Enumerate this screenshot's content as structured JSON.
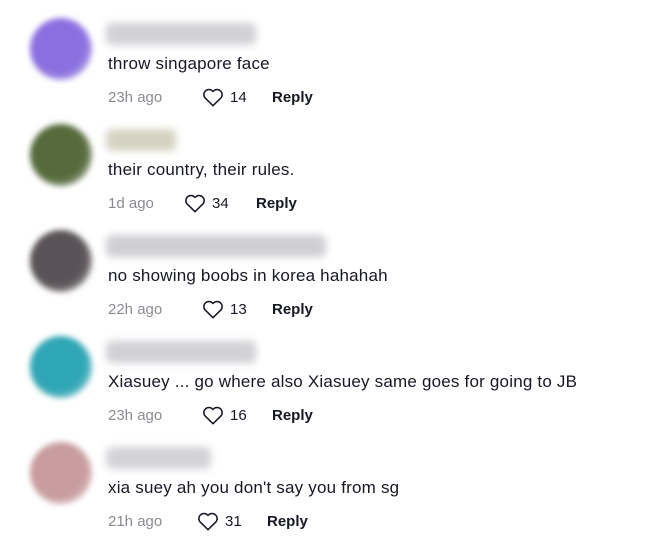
{
  "comments": [
    {
      "text": "throw singapore face",
      "time": "23h ago",
      "likes": "14",
      "reply": "Reply",
      "avatar_color": "#8b6fe0",
      "username_color": "#c9c9cf",
      "username_width": 150
    },
    {
      "text": "their country, their rules.",
      "time": "1d ago",
      "likes": "34",
      "reply": "Reply",
      "avatar_color": "#556b3c",
      "username_color": "#cfcab8",
      "username_width": 70
    },
    {
      "text": "no showing boobs in korea hahahah",
      "time": "22h ago",
      "likes": "13",
      "reply": "Reply",
      "avatar_color": "#5a5256",
      "username_color": "#c6c6cc",
      "username_width": 220
    },
    {
      "text": "Xiasuey ... go where also Xiasuey same goes for going to JB",
      "time": "23h ago",
      "likes": "16",
      "reply": "Reply",
      "avatar_color": "#2fa6b5",
      "username_color": "#c8c8ce",
      "username_width": 150
    },
    {
      "text": "xia suey ah you don't say you from sg",
      "time": "21h ago",
      "likes": "31",
      "reply": "Reply",
      "avatar_color": "#c99c9e",
      "username_color": "#cbcbd1",
      "username_width": 105
    }
  ]
}
